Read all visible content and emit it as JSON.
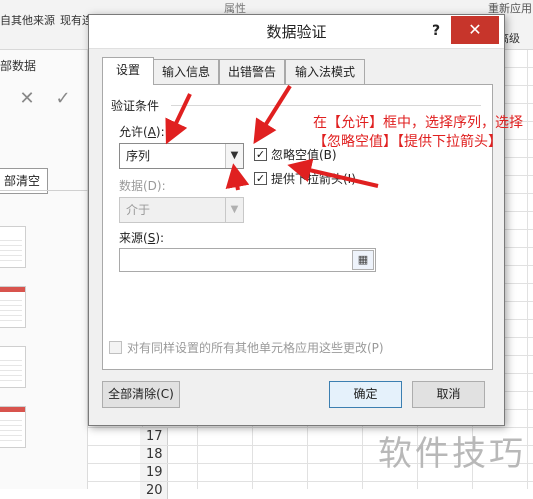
{
  "background": {
    "ribbon_items": [
      "自其他来源",
      "现有连接",
      "属性",
      "重新应用",
      "高级"
    ],
    "sheet_label": "部数据",
    "clear_button": "部清空",
    "row_numbers": [
      "17",
      "18",
      "19",
      "20"
    ],
    "watermark": "软件技巧"
  },
  "dialog": {
    "title": "数据验证",
    "help_label": "?",
    "close_label": "✕",
    "tabs": [
      {
        "label": "设置",
        "active": true
      },
      {
        "label": "输入信息",
        "active": false
      },
      {
        "label": "出错警告",
        "active": false
      },
      {
        "label": "输入法模式",
        "active": false
      }
    ],
    "section_title": "验证条件",
    "allow": {
      "label": "允许(",
      "key": "A",
      "tail": "):",
      "value": "序列"
    },
    "data": {
      "label": "数据(D):",
      "value": "介于"
    },
    "ignore_blank": {
      "label": "忽略空值(B)",
      "checked": true
    },
    "dropdown_arrow": {
      "label": "提供下拉箭头(I)",
      "checked": true
    },
    "source": {
      "label": "来源(",
      "key": "S",
      "tail": "):",
      "value": ""
    },
    "apply_all": {
      "label": "对有同样设置的所有其他单元格应用这些更改(P)",
      "checked": false
    },
    "buttons": {
      "clear_all": "全部清除(C)",
      "ok": "确定",
      "cancel": "取消"
    }
  },
  "annotation": {
    "text": "在【允许】框中，选择序列，选择【忽略空值】【提供下拉箭头】",
    "color": "#e02020"
  }
}
